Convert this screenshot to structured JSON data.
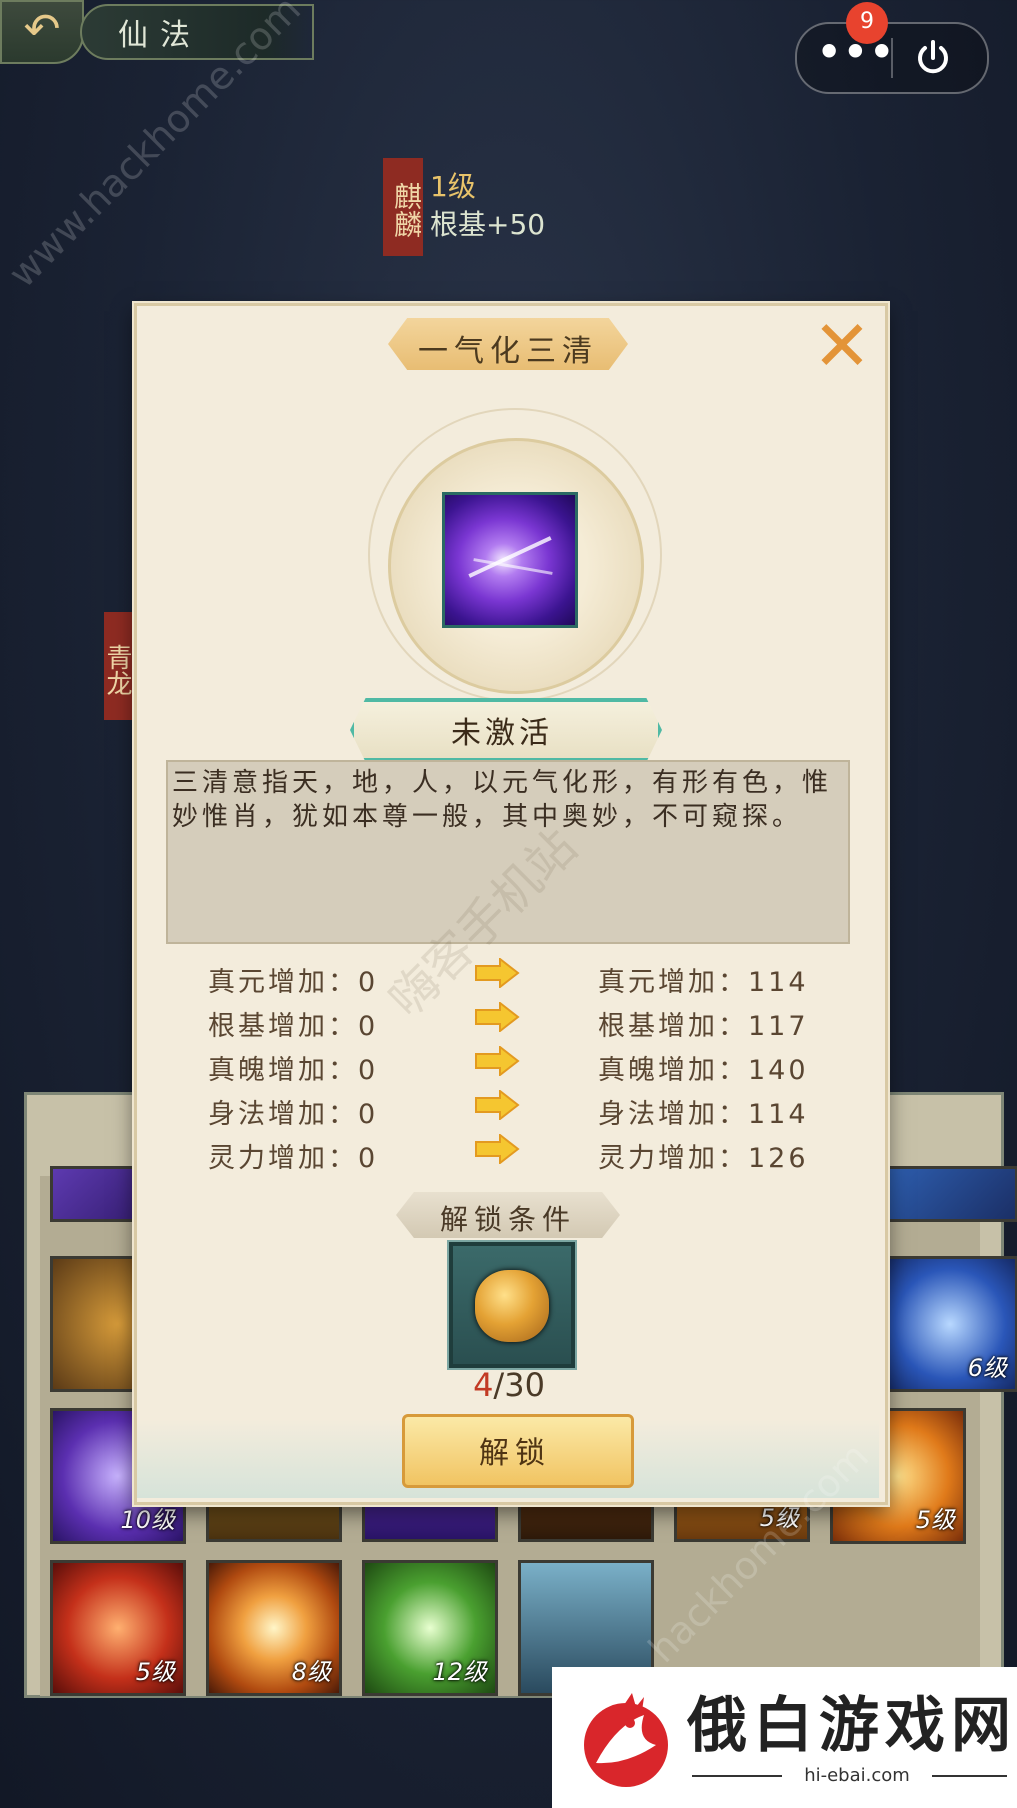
{
  "topbar": {
    "back_icon": "back-arrow-icon",
    "title": "仙法",
    "notification_count": "9",
    "more_icon": "more-dots-icon",
    "power_icon": "power-icon"
  },
  "hero": {
    "qilin_name": "麒麟",
    "qilin_level": "1级",
    "qilin_bonus": "根基+50",
    "qinglong_name": "青龙"
  },
  "dialog": {
    "title": "一气化三清",
    "close_icon": "close-x-icon",
    "skill_icon": "purple-lightning-skill-icon",
    "status": "未激活",
    "description": "三清意指天，地，人，以元气化形，有形有色，惟妙惟肖，犹如本尊一般，其中奥妙，不可窥探。",
    "stats": [
      {
        "label": "真元增加：",
        "current": "0",
        "next": "114"
      },
      {
        "label": "根基增加：",
        "current": "0",
        "next": "117"
      },
      {
        "label": "真魄增加：",
        "current": "0",
        "next": "140"
      },
      {
        "label": "身法增加：",
        "current": "0",
        "next": "114"
      },
      {
        "label": "灵力增加：",
        "current": "0",
        "next": "126"
      }
    ],
    "unlock_condition_title": "解锁条件",
    "unlock_item_icon": "golden-qilin-token-icon",
    "unlock_have": "4",
    "unlock_need": "/30",
    "unlock_button": "解锁"
  },
  "grid_levels": [
    "6级",
    "10级",
    "5级",
    "5级",
    "5级",
    "8级",
    "12级"
  ],
  "watermarks": {
    "top": "www.hackhome.com",
    "middle": "嗨客手机站",
    "bottom": "hackhome.com"
  },
  "brand": {
    "name": "俄白游戏网",
    "url": "hi-ebai.com",
    "logo_icon": "rooster-logo-icon"
  },
  "colors": {
    "accent_gold": "#f1c462",
    "status_border": "#4fb9a4",
    "count_red": "#c23a24",
    "badge_red": "#e8432e"
  }
}
